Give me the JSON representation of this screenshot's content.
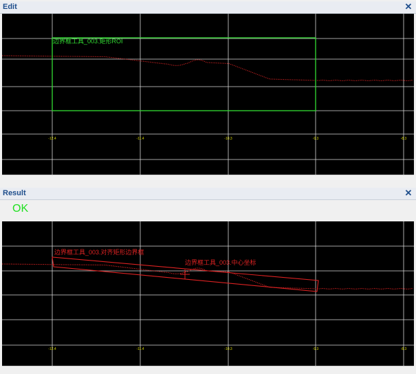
{
  "edit_panel": {
    "title": "Edit",
    "close_glyph": "✕",
    "roi_label": "边界框工具_003.矩形ROI",
    "tick_labels": [
      "-12.4",
      "-11.4",
      "-10.3",
      "-9.3",
      "-8.3"
    ],
    "roi_color": "#33dd33",
    "tick_color": "#d8d800",
    "grid_color": "#d8d8d8",
    "profile_color": "#cc2222"
  },
  "result_panel": {
    "title": "Result",
    "close_glyph": "✕",
    "status": "OK",
    "status_color": "#20e020",
    "box_label": "边界框工具_003.对齐矩形边界框",
    "center_label": "边界框工具_003.中心坐标",
    "tick_labels": [
      "-12.4",
      "-11.4",
      "-10.3",
      "-9.3",
      "-8.3"
    ],
    "overlay_color": "#dd2222"
  }
}
